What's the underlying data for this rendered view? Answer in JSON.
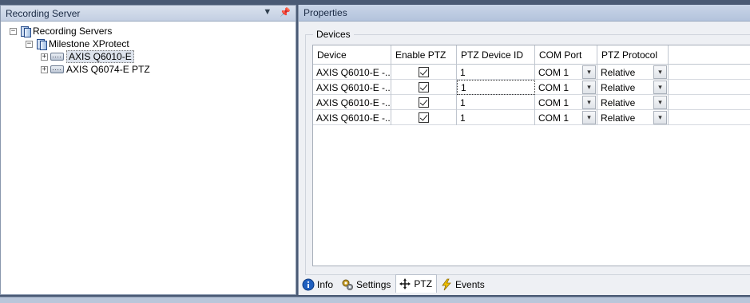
{
  "left_pane": {
    "title": "Recording Server",
    "pin_icon": "pin-icon",
    "menu_icon": "chevron-down-icon",
    "tree": {
      "root": {
        "label": "Recording Servers",
        "expander": "−"
      },
      "server": {
        "label": "Milestone XProtect",
        "expander": "−"
      },
      "cameras": [
        {
          "label": "AXIS Q6010-E",
          "expander": "+"
        },
        {
          "label": "AXIS Q6074-E PTZ",
          "expander": "+"
        }
      ]
    }
  },
  "right_pane": {
    "title": "Properties",
    "group_label": "Devices",
    "columns": [
      "Device",
      "Enable PTZ",
      "PTZ Device ID",
      "COM Port",
      "PTZ Protocol"
    ],
    "rows": [
      {
        "device": "AXIS  Q6010-E  -...",
        "enable_ptz": true,
        "ptz_id": "1",
        "com_port": "COM 1",
        "protocol": "Relative"
      },
      {
        "device": "AXIS  Q6010-E  -...",
        "enable_ptz": true,
        "ptz_id": "1",
        "com_port": "COM 1",
        "protocol": "Relative"
      },
      {
        "device": "AXIS  Q6010-E  -...",
        "enable_ptz": true,
        "ptz_id": "1",
        "com_port": "COM 1",
        "protocol": "Relative"
      },
      {
        "device": "AXIS  Q6010-E  -...",
        "enable_ptz": true,
        "ptz_id": "1",
        "com_port": "COM 1",
        "protocol": "Relative"
      }
    ],
    "tabs": [
      {
        "label": "Info",
        "icon": "info-icon"
      },
      {
        "label": "Settings",
        "icon": "settings-icon"
      },
      {
        "label": "PTZ",
        "icon": "ptz-move-icon"
      },
      {
        "label": "Events",
        "icon": "events-lightning-icon"
      }
    ],
    "active_tab": "PTZ"
  },
  "colors": {
    "header": "#c3cfe2",
    "accent": "#1f5fbf"
  }
}
